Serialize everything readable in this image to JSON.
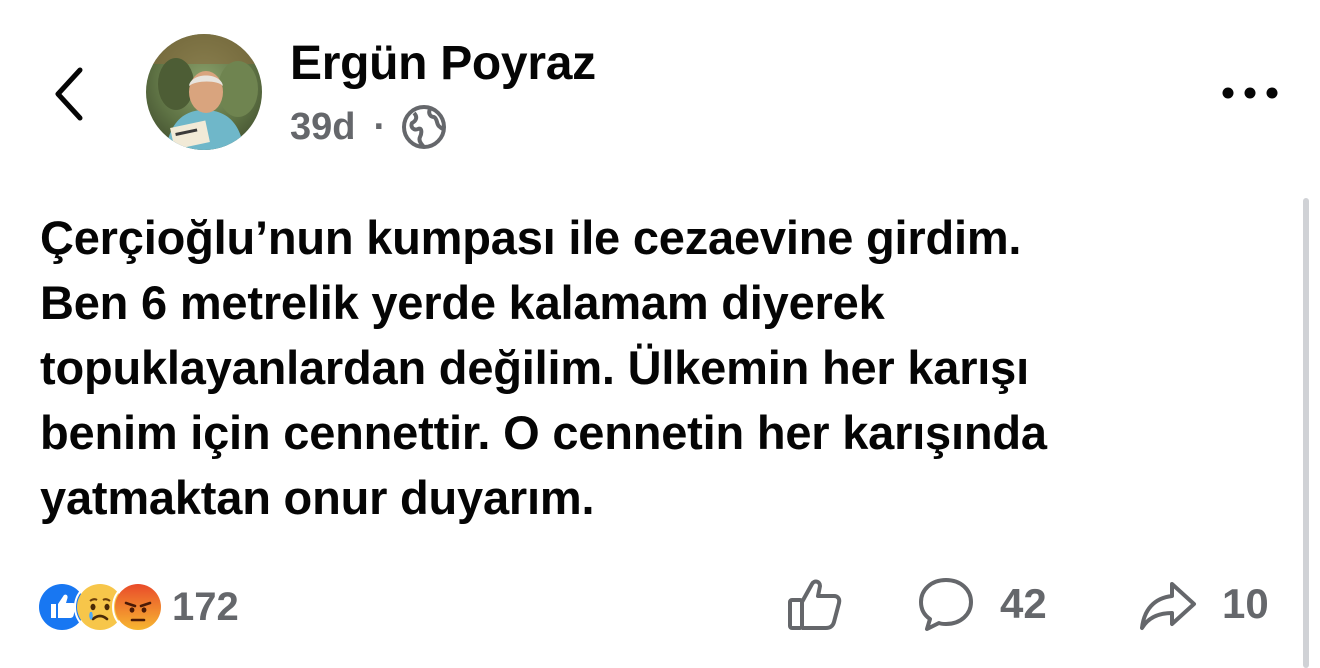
{
  "header": {
    "author": "Ergün Poyraz",
    "time": "39d",
    "separator": "·"
  },
  "post": {
    "lines": [
      "Çerçioğlu’nun kumpası ile cezaevine girdim.",
      "Ben 6 metrelik yerde kalamam diyerek",
      "topuklayanlardan değilim. Ülkemin her karışı",
      "benim için cennettir. O cennetin her karışında",
      "yatmaktan onur duyarım."
    ]
  },
  "reactions": {
    "types": [
      "like-icon",
      "sad-icon",
      "angry-icon"
    ],
    "count": "172"
  },
  "actions": {
    "comments": "42",
    "shares": "10"
  },
  "colors": {
    "text": "#050505",
    "secondary": "#65676b",
    "like_blue": "#1877f2",
    "angry_red": "#e9710f"
  }
}
